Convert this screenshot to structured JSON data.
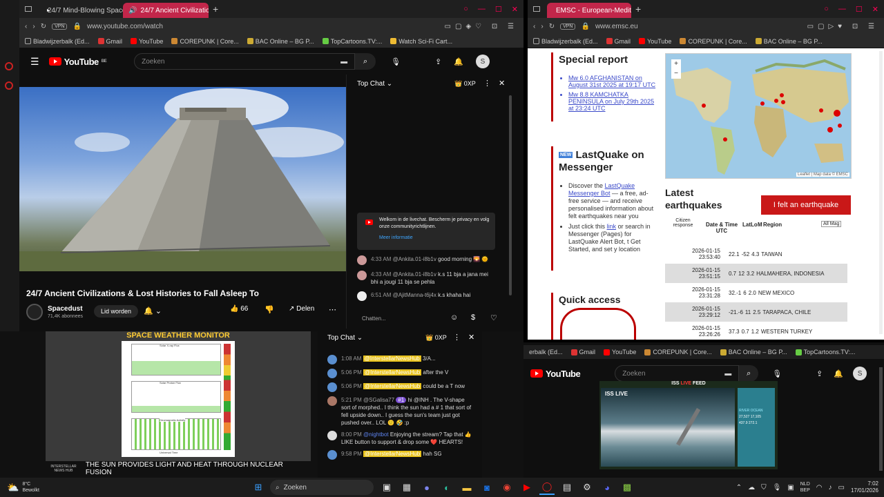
{
  "left_browser": {
    "tabs": [
      {
        "label": "24/7 Mind-Blowing Space"
      },
      {
        "label": "24/7 Ancient Civilizatio"
      }
    ],
    "url": "www.youtube.com/watch",
    "vpn": "VPN",
    "bookmarks": [
      "Bladwijzerbalk (Ed...",
      "Gmail",
      "YouTube",
      "COREPUNK | Core...",
      "BAC Online – BG P...",
      "TopCartoons.TV:...",
      "Watch Sci-Fi Cart..."
    ],
    "yt_logo": "YouTube",
    "yt_region": "BE",
    "search_placeholder": "Zoeken",
    "avatar": "S",
    "video_title": "24/7 Ancient Civilizations & Lost Histories to Fall Asleep To",
    "channel": "Spacedust",
    "subscribers": "71,4K abonnees",
    "join_label": "Lid worden",
    "likes": "66",
    "share_label": "Delen",
    "chat": {
      "title": "Top Chat",
      "points": "0XP",
      "welcome": "Welkom in de livechat. Bescherm je privacy en volg onze communityrichtlijnen.",
      "more_info": "Meer informatie",
      "messages": [
        {
          "time": "4:33 AM",
          "user": "@Ankita.01-i8b1v",
          "text": "good morning 🌄 🌞"
        },
        {
          "time": "4:33 AM",
          "user": "@Ankita.01-i8b1v",
          "text": "k.s 11 bja a jana mei bhi a jougi 11 bja se pehla"
        },
        {
          "time": "6:51 AM",
          "user": "@AjitManna-t6j4x",
          "text": "k.s khaha hai"
        }
      ],
      "input_placeholder": "Chatten..."
    }
  },
  "space_stream": {
    "title": "SPACE WEATHER MONITOR",
    "panels": [
      "Solar X-ray Flux",
      "Solar Proton Flux",
      "Geomagnetic Activity"
    ],
    "xaxis": "Universal Time",
    "ticker": "THE SUN PROVIDES LIGHT AND HEAT THROUGH NUCLEAR FUSION",
    "logo": "INTERSTELLAR NEWS HUB",
    "chat": {
      "title": "Top Chat",
      "points": "0XP",
      "messages": [
        {
          "time": "1:08 AM",
          "user": "@InterstellarNewsHub",
          "text": "3/A..."
        },
        {
          "time": "5:06 PM",
          "user": "@InterstellarNewsHub",
          "text": "after the V"
        },
        {
          "time": "5:06 PM",
          "user": "@InterstellarNewsHub",
          "text": "could be a T now"
        },
        {
          "time": "5:21 PM",
          "user": "@SGalisa77",
          "badge": "#1",
          "text": "hi @INH . The V-shape sort of morphed.. I think the sun had a # 1 that sort of fell upside down.. I guess the sun's team just got pushed over.. LOL 🙂 🤣 :p"
        },
        {
          "time": "8:00 PM",
          "user": "@nightbot",
          "text": "Enjoying the stream? Tap that 👍 LIKE button to support & drop some ❤️ HEARTS!"
        },
        {
          "time": "9:58 PM",
          "user": "@InterstellarNewsHub",
          "text": "hah SG"
        }
      ]
    }
  },
  "right_browser": {
    "tabs": [
      {
        "label": "EMSC - European-Mediter"
      }
    ],
    "url": "www.emsc.eu",
    "bookmarks": [
      "Bladwijzerbalk (Ed...",
      "Gmail",
      "YouTube",
      "COREPUNK | Core...",
      "BAC Online – BG P..."
    ],
    "special_report": {
      "title": "Special report",
      "items": [
        "Mw 6.0 AFGHANISTAN on August 31st 2025 at 19:17 UTC",
        "Mw 8.8 KAMCHATKA PENINSULA on July 29th 2025 at 23:24 UTC"
      ]
    },
    "map_attrib": "Leaflet | Map data © EMSC",
    "lastquake": {
      "new": "NEW",
      "title": "LastQuake on Messenger",
      "b1_pre": "Discover the",
      "b1_link": "LastQuake Messenger Bot",
      "b1_post": "— a free, ad-free service — and receive personalised information about felt earthquakes near you",
      "b2_pre": "Just click this",
      "b2_link": "link",
      "b2_post": "or search in Messenger (Pages) for LastQuake Alert Bot, t Get Started, and set y location"
    },
    "latest": {
      "title": "Latest earthquakes",
      "felt_button": "I felt an earthquake",
      "headers": [
        "Citizen response",
        "Date & Time UTC",
        "Lat. degrees",
        "Lon. degrees",
        "M",
        "Region"
      ],
      "filter": "All Mag",
      "rows": [
        {
          "date": "2026-01-15",
          "time": "23:53:40",
          "lat": "22.1",
          "lon": "-52",
          "mag": "4.3",
          "region": "TAIWAN"
        },
        {
          "date": "2026-01-15",
          "time": "23:51:15",
          "lat": "0.7",
          "lon": "12",
          "mag": "3.2",
          "region": "HALMAHERA, INDONESIA"
        },
        {
          "date": "2026-01-15",
          "time": "23:31:28",
          "lat": "32.-1",
          "lon": "6",
          "mag": "2.0",
          "region": "NEW MEXICO"
        },
        {
          "date": "2026-01-15",
          "time": "23:29:12",
          "lat": "-21.-6",
          "lon": "11",
          "mag": "2.5",
          "region": "TARAPACA, CHILE"
        },
        {
          "date": "2026-01-15",
          "time": "23:26:26",
          "lat": "37.3",
          "lon": "0.7",
          "mag": "1.2",
          "region": "WESTERN TURKEY"
        }
      ]
    },
    "quick_access": "Quick access"
  },
  "iss_window": {
    "bookmarks": [
      "erbalk (Ed...",
      "Gmail",
      "YouTube",
      "COREPUNK | Core...",
      "BAC Online – BG P...",
      "TopCartoons.TV:..."
    ],
    "yt_logo": "YouTube",
    "search_placeholder": "Zoeken",
    "avatar": "S",
    "feed_title": "ISS",
    "feed_live": "LIVE",
    "feed_title_suffix": "FEED",
    "feed_label": "ISS LIVE",
    "stats": [
      "RIVER OCEAN",
      "27,527",
      "17,105",
      "437.9",
      "272.1"
    ]
  },
  "taskbar": {
    "temp": "8°C",
    "weather": "Bewolkt",
    "search": "Zoeken",
    "lang1": "NLD",
    "lang2": "BEP",
    "time": "7:02",
    "date": "17/01/2026"
  }
}
